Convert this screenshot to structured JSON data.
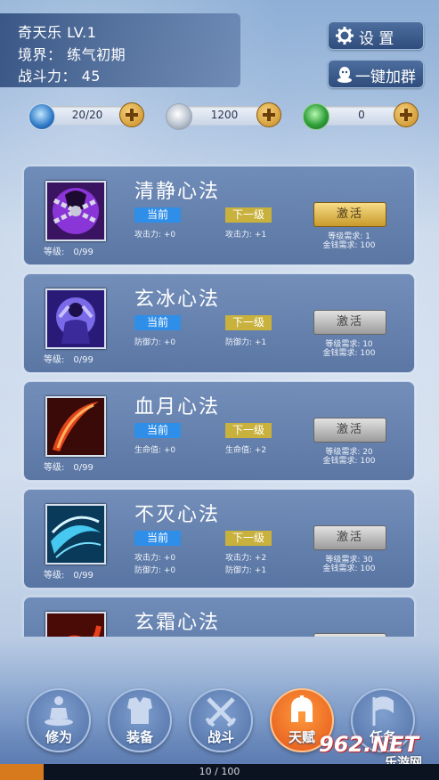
{
  "player": {
    "name_level": "奇天乐 LV.1",
    "realm": "境界：  练气初期",
    "power": "战斗力：  45"
  },
  "top_buttons": {
    "settings": "设 置",
    "join_group": "一键加群"
  },
  "resources": [
    {
      "icon": "energy-orb-icon",
      "value": "20/20"
    },
    {
      "icon": "silver-coin-icon",
      "value": "1200"
    },
    {
      "icon": "jade-gem-icon",
      "value": "0"
    }
  ],
  "skills": [
    {
      "title": "清静心法",
      "icon": "chained-demon-icon",
      "level_label": "等级:",
      "level_value": "0/99",
      "current_label": "当前",
      "next_label": "下一级",
      "current_stats": [
        "攻击力: +0"
      ],
      "next_stats": [
        "攻击力: +1"
      ],
      "action": "激活",
      "action_state": "gold",
      "req_level": "等级需求: 1",
      "req_gold": "金钱需求: 100"
    },
    {
      "title": "玄冰心法",
      "icon": "ice-warrior-icon",
      "level_label": "等级:",
      "level_value": "0/99",
      "current_label": "当前",
      "next_label": "下一级",
      "current_stats": [
        "防御力: +0"
      ],
      "next_stats": [
        "防御力: +1"
      ],
      "action": "激活",
      "action_state": "gray",
      "req_level": "等级需求: 10",
      "req_gold": "金钱需求: 100"
    },
    {
      "title": "血月心法",
      "icon": "blood-slash-icon",
      "level_label": "等级:",
      "level_value": "0/99",
      "current_label": "当前",
      "next_label": "下一级",
      "current_stats": [
        "生命值: +0"
      ],
      "next_stats": [
        "生命值: +2"
      ],
      "action": "激活",
      "action_state": "gray",
      "req_level": "等级需求: 20",
      "req_gold": "金钱需求: 100"
    },
    {
      "title": "不灭心法",
      "icon": "ice-vortex-icon",
      "level_label": "等级:",
      "level_value": "0/99",
      "current_label": "当前",
      "next_label": "下一级",
      "current_stats": [
        "攻击力: +0",
        "防御力: +0"
      ],
      "next_stats": [
        "攻击力: +2",
        "防御力: +1"
      ],
      "action": "激活",
      "action_state": "gray",
      "req_level": "等级需求: 30",
      "req_gold": "金钱需求: 100"
    },
    {
      "title": "玄霜心法",
      "icon": "fire-rune-icon",
      "level_label": "",
      "level_value": "",
      "current_label": "",
      "next_label": "",
      "current_stats": [],
      "next_stats": [],
      "action": "",
      "action_state": "gray",
      "req_level": "",
      "req_gold": ""
    }
  ],
  "nav": [
    {
      "label": "修为",
      "icon": "meditation-icon",
      "active": false
    },
    {
      "label": "装备",
      "icon": "armor-icon",
      "active": false
    },
    {
      "label": "战斗",
      "icon": "crossed-swords-icon",
      "active": false
    },
    {
      "label": "天赋",
      "icon": "spartan-helmet-icon",
      "active": true
    },
    {
      "label": "任务",
      "icon": "flag-icon",
      "active": false
    }
  ],
  "exp": {
    "text": "10 / 100",
    "progress": 0.1
  },
  "watermark": {
    "brand": "962.NET",
    "sub": "乐游网"
  }
}
